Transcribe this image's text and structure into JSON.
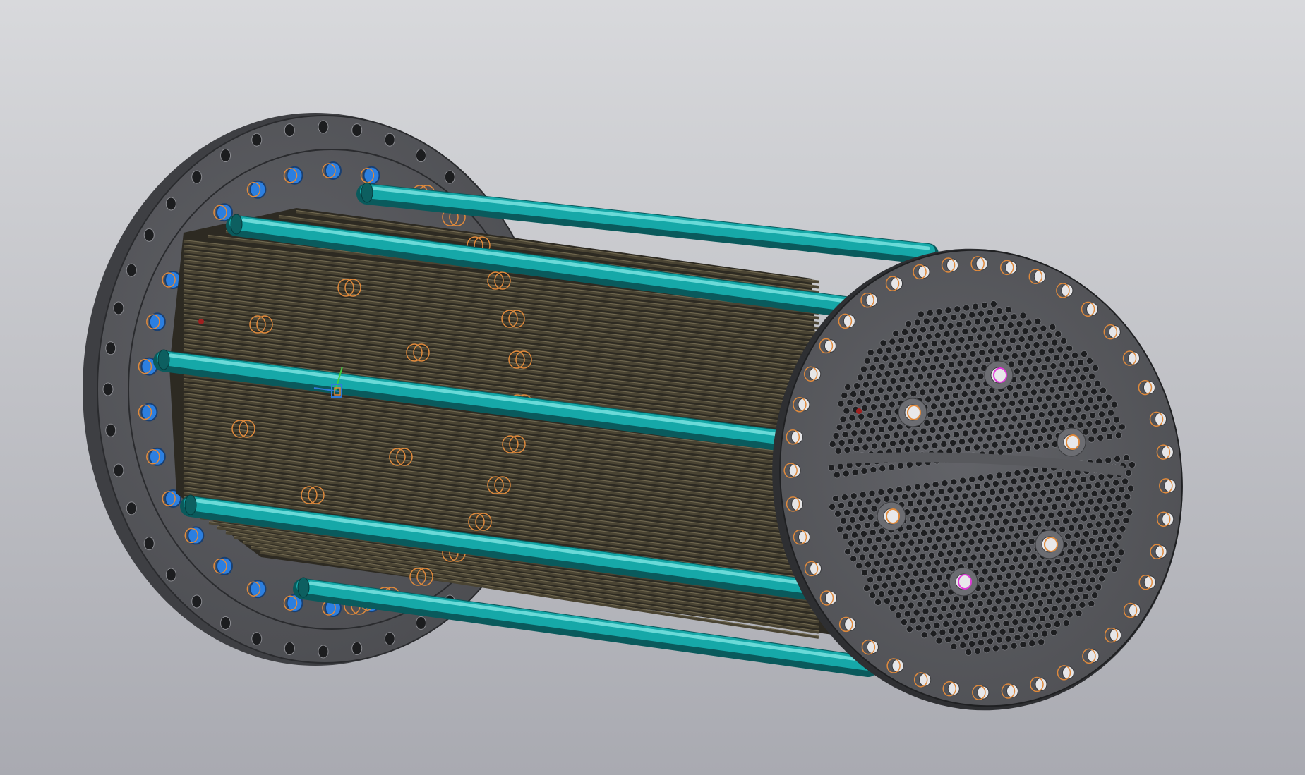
{
  "viewport": {
    "background_top": "#d8d9dc",
    "background_bottom": "#a9aab1"
  },
  "model": {
    "component": "heat-exchanger-tube-bundle",
    "parts": [
      "rear-tubesheet-flange",
      "tube-bundle",
      "tie-rods",
      "front-tubesheet",
      "flange-bolt-holes",
      "pass-partition"
    ],
    "colors": {
      "tubesheet_face": "#58595d",
      "tubesheet_edge": "#2e2f32",
      "tubes": "#4a4433",
      "tube_highlight": "#8c8266",
      "tie_rods": "#16a8a8",
      "tie_rod_highlight": "#7fe6e3",
      "bolt_hole_markers": "#e08a3c",
      "inner_hole_fill": "#2c7fe0",
      "selected_marker": "#e03ad8",
      "origin_axis_x": "#2f7bd8",
      "origin_axis_y": "#3fcf3f"
    }
  }
}
